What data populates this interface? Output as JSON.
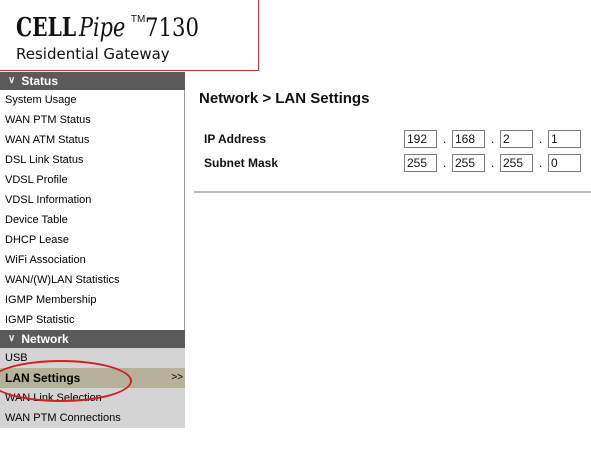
{
  "logo": {
    "brand_cell": "CELL",
    "brand_pipe": "Pipe",
    "trademark": "TM",
    "model": "7130",
    "subtitle": "Residential Gateway"
  },
  "sidebar": {
    "status_header": "Status",
    "status_items": [
      "System Usage",
      "WAN PTM Status",
      "WAN ATM Status",
      "DSL Link Status",
      "VDSL Profile",
      "VDSL Information",
      "Device Table",
      "DHCP Lease",
      "WiFi Association",
      "WAN/(W)LAN Statistics",
      "IGMP Membership",
      "IGMP Statistic"
    ],
    "network_header": "Network",
    "network_items": [
      "USB",
      "LAN Settings",
      "WAN Link Selection",
      "WAN PTM Connections"
    ],
    "active_item": "LAN Settings",
    "active_arrow": ">>"
  },
  "main": {
    "title": "Network > LAN Settings",
    "ip_label": "IP Address",
    "ip_octets": [
      "192",
      "168",
      "2",
      "1"
    ],
    "subnet_label": "Subnet Mask",
    "subnet_octets": [
      "255",
      "255",
      "255",
      "0"
    ],
    "separator": "."
  },
  "colors": {
    "header_bg": "#5a5a5a",
    "active_bg": "#b6b29a",
    "gray_list_bg": "#d4d4d4",
    "highlight_red": "#d21f1f"
  }
}
